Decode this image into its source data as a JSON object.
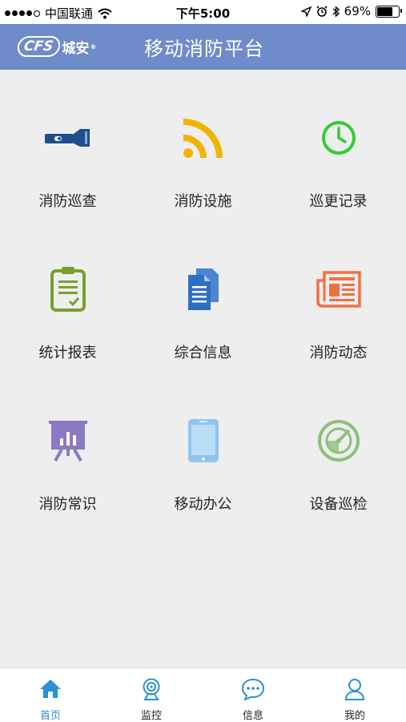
{
  "status_bar": {
    "carrier": "中国联通",
    "time": "下午5:00",
    "battery_text": "69%",
    "battery_level": 0.69
  },
  "header": {
    "logo_text": "CFS",
    "logo_cn": "城安",
    "logo_mark": "®",
    "title": "移动消防平台",
    "color": "#6f8bc9"
  },
  "menu": {
    "items": [
      {
        "label": "消防巡查",
        "icon": "flashlight-icon",
        "color": "#1f4e8c"
      },
      {
        "label": "消防设施",
        "icon": "rss-icon",
        "color": "#f0b400"
      },
      {
        "label": "巡更记录",
        "icon": "clock-icon",
        "color": "#33cc33"
      },
      {
        "label": "统计报表",
        "icon": "clipboard-icon",
        "color": "#7aa02a"
      },
      {
        "label": "综合信息",
        "icon": "documents-icon",
        "color": "#2f6fc0"
      },
      {
        "label": "消防动态",
        "icon": "newspaper-icon",
        "color": "#f07040"
      },
      {
        "label": "消防常识",
        "icon": "presentation-icon",
        "color": "#8b79c2"
      },
      {
        "label": "移动办公",
        "icon": "tablet-icon",
        "color": "#8fc4f0"
      },
      {
        "label": "设备巡检",
        "icon": "radar-icon",
        "color": "#8fbf7a"
      }
    ]
  },
  "tabs": [
    {
      "label": "首页",
      "icon": "home-icon",
      "active": true
    },
    {
      "label": "监控",
      "icon": "webcam-icon",
      "active": false
    },
    {
      "label": "信息",
      "icon": "chat-icon",
      "active": false
    },
    {
      "label": "我的",
      "icon": "user-icon",
      "active": false
    }
  ],
  "colors": {
    "active_tab": "#2a8fd6",
    "background": "#eeeeef"
  }
}
